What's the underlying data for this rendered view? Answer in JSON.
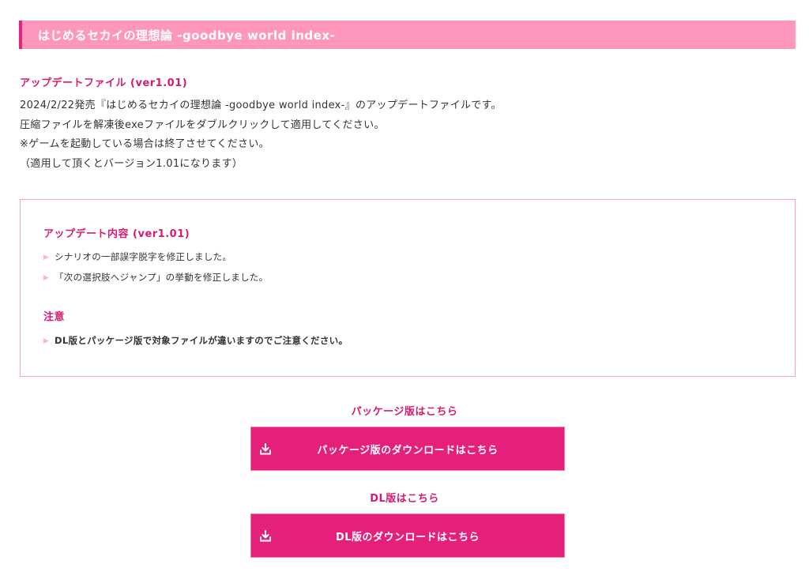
{
  "title_bar": {
    "title": "はじめるセカイの理想論 -goodbye world index-"
  },
  "update": {
    "heading": "アップデートファイル (ver1.01)",
    "lines": [
      "2024/2/22発売『はじめるセカイの理想論 -goodbye world index-』のアップデートファイルです。",
      "圧縮ファイルを解凍後exeファイルをダブルクリックして適用してください。",
      "※ゲームを起動している場合は終了させてください。",
      "（適用して頂くとバージョン1.01になります）"
    ]
  },
  "info_box": {
    "content_heading": "アップデート内容 (ver1.01)",
    "content_items": [
      "シナリオの一部誤字脱字を修正しました。",
      "「次の選択肢へジャンプ」の挙動を修正しました。"
    ],
    "notice_heading": "注意",
    "notice_items": [
      "DL版とパッケージ版で対象ファイルが違いますのでご注意ください。"
    ],
    "bullet_glyph": "▶"
  },
  "package": {
    "label": "パッケージ版はこちら",
    "button": "パッケージ版のダウンロードはこちら"
  },
  "dl": {
    "label": "DL版はこちら",
    "button": "DL版のダウンロードはこちら"
  },
  "icons": {
    "download": "download-icon"
  },
  "colors": {
    "title_bar_bg": "#ff96bc",
    "title_bar_accent": "#e8237b",
    "heading_pink": "#d81b72",
    "button_bg": "#e5207a",
    "box_border": "#ff9fc2"
  }
}
